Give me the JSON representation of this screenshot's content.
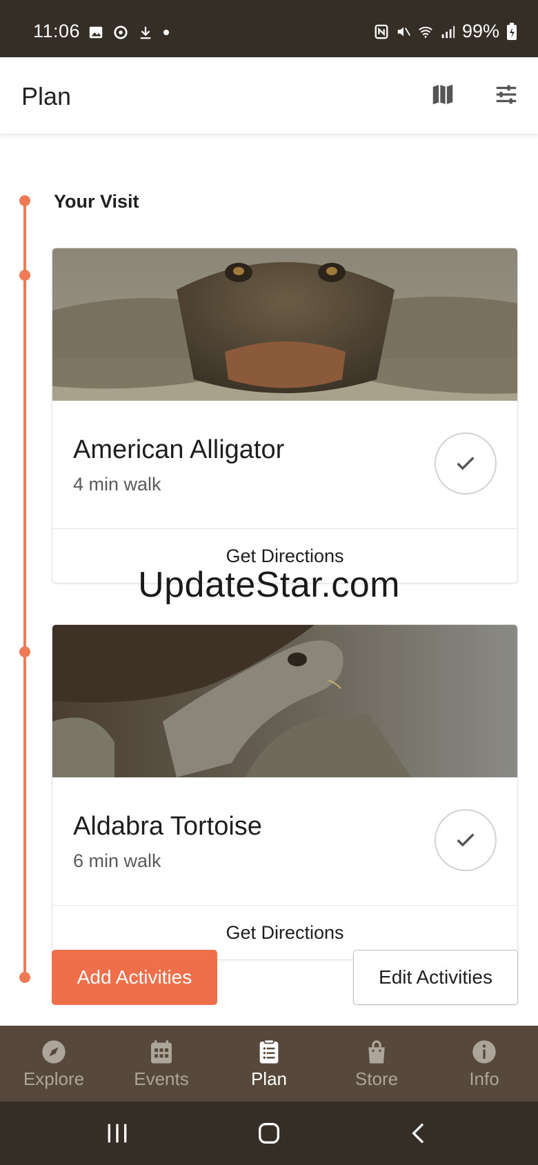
{
  "status_bar": {
    "time": "11:06",
    "battery": "99%"
  },
  "header": {
    "title": "Plan",
    "map_icon": "map-icon",
    "filter_icon": "sliders-icon"
  },
  "visit": {
    "title": "Your Visit",
    "activities": [
      {
        "name": "American Alligator",
        "walk": "4 min walk",
        "directions_label": "Get Directions",
        "image": "alligator-photo"
      },
      {
        "name": "Aldabra Tortoise",
        "walk": "6 min walk",
        "directions_label": "Get Directions",
        "image": "tortoise-photo"
      }
    ]
  },
  "watermark": "UpdateStar.com",
  "actions": {
    "add_label": "Add Activities",
    "edit_label": "Edit Activities"
  },
  "bottom_nav": {
    "items": [
      {
        "label": "Explore",
        "icon": "compass-icon",
        "active": false
      },
      {
        "label": "Events",
        "icon": "calendar-icon",
        "active": false
      },
      {
        "label": "Plan",
        "icon": "clipboard-icon",
        "active": true
      },
      {
        "label": "Store",
        "icon": "shopping-bag-icon",
        "active": false
      },
      {
        "label": "Info",
        "icon": "info-icon",
        "active": false
      }
    ]
  },
  "colors": {
    "accent": "#ef6f4a",
    "timeline": "#ef7b56",
    "nav_bg": "#56493b",
    "status_bg": "#352e26"
  }
}
